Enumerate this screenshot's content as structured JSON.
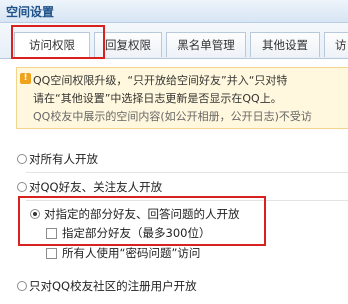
{
  "header": {
    "title": "空间设置"
  },
  "tabs": [
    {
      "label": "访问权限",
      "active": true
    },
    {
      "label": "回复权限",
      "active": false
    },
    {
      "label": "黑名单管理",
      "active": false
    },
    {
      "label": "其他设置",
      "active": false
    },
    {
      "label": "访",
      "active": false
    }
  ],
  "notice": {
    "icon": "warning-icon",
    "line1": "QQ空间权限升级，“只开放给空间好友”并入“只对特",
    "line2": "请在“其他设置”中选择日志更新是否显示在QQ上。",
    "line3": "QQ校友中展示的空间内容(如公开相册，公开日志)不受访"
  },
  "options": [
    {
      "label": "对所有人开放",
      "selected": false
    },
    {
      "label": "对QQ好友、关注友人开放",
      "selected": false
    },
    {
      "label": "对指定的部分好友、回答问题的人开放",
      "selected": true
    },
    {
      "label": "只对QQ校友社区的注册用户开放",
      "selected": false
    }
  ],
  "sub_options": [
    {
      "label": "指定部分好友（最多300位）",
      "checked": false
    },
    {
      "label": "所有人使用“密码问题”访问",
      "checked": false
    }
  ],
  "colors": {
    "highlight": "#d9211f",
    "title": "#1f5289",
    "notice_bg": "#fff8de"
  }
}
